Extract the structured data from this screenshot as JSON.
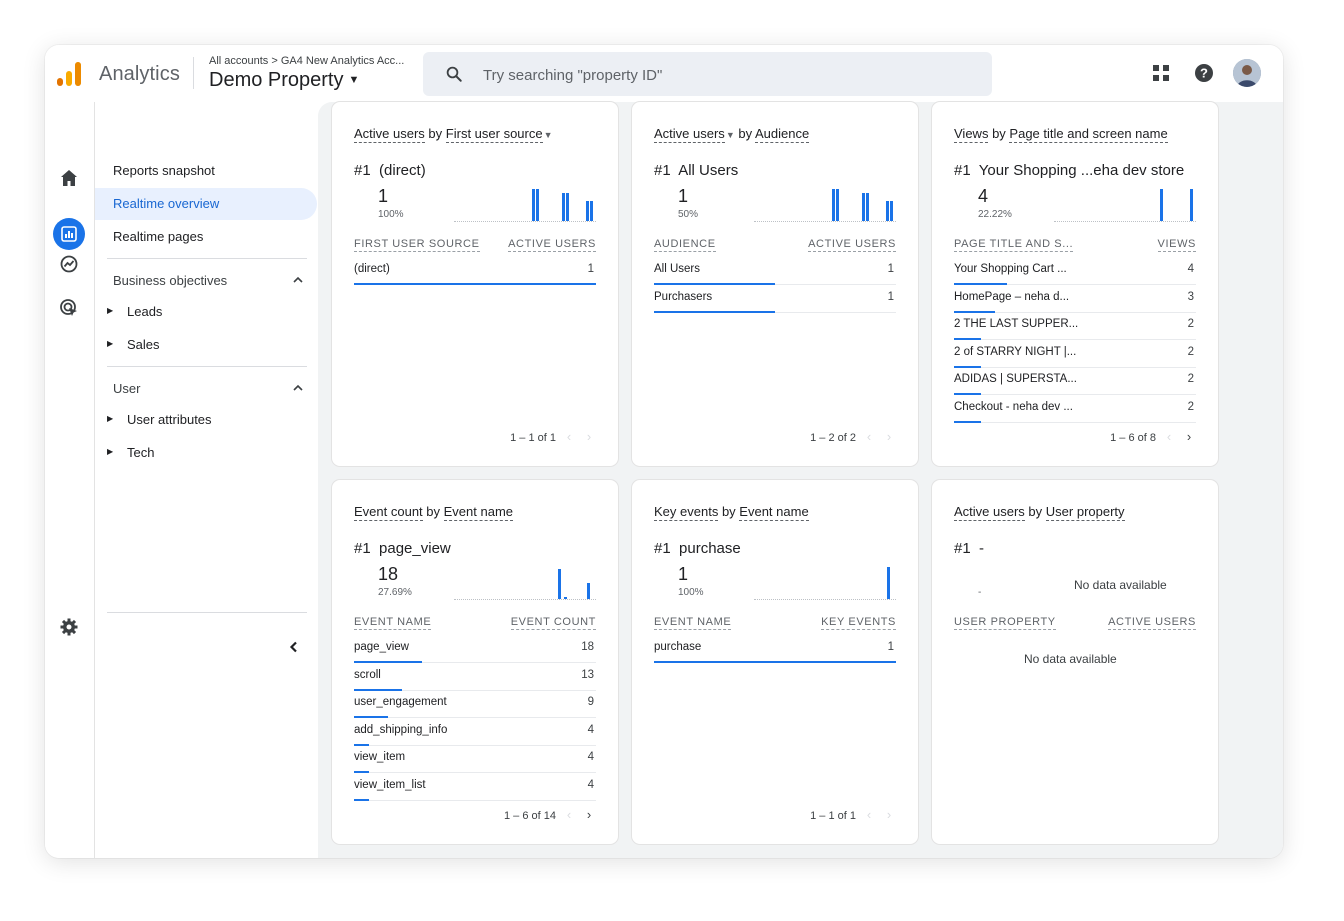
{
  "app": {
    "name": "Analytics",
    "breadcrumb": "All accounts > GA4 New Analytics Acc...",
    "property": "Demo Property"
  },
  "search": {
    "placeholder": "Try searching \"property ID\""
  },
  "header_icons": [
    "apps-grid-icon",
    "help-icon",
    "avatar"
  ],
  "rail_icons": [
    "home-icon",
    "reports-icon",
    "explore-icon",
    "advertising-icon",
    "settings-icon"
  ],
  "nav": {
    "items": [
      {
        "label": "Reports snapshot",
        "active": false
      },
      {
        "label": "Realtime overview",
        "active": true
      },
      {
        "label": "Realtime pages",
        "active": false
      }
    ],
    "sections": [
      {
        "title": "Business objectives",
        "children": [
          "Leads",
          "Sales"
        ]
      },
      {
        "title": "User",
        "children": [
          "User attributes",
          "Tech"
        ]
      }
    ]
  },
  "colors": {
    "accent": "#1a73e8",
    "active_bg": "#e8f0fe",
    "content_bg": "#f1f3f4"
  },
  "cards": [
    {
      "title_pre": "Active users",
      "title_mid": " by ",
      "title_post": "First user source",
      "dropdown_on": "post",
      "rank": "#1  (direct)",
      "value": "1",
      "pct": "100%",
      "spark": [
        20,
        20,
        28,
        28,
        32,
        32
      ],
      "col_left": "FIRST USER SOURCE",
      "col_right": "ACTIVE USERS",
      "rows": [
        {
          "k": "(direct)",
          "v": "1",
          "frac": 1.0
        }
      ],
      "pager": "1 – 1 of 1",
      "next_on": false
    },
    {
      "title_pre": "Active users",
      "title_mid": " by ",
      "title_post": "Audience",
      "dropdown_on": "pre",
      "rank": "#1  All Users",
      "value": "1",
      "pct": "50%",
      "spark": [
        20,
        20,
        28,
        28,
        32,
        32
      ],
      "col_left": "AUDIENCE",
      "col_right": "ACTIVE USERS",
      "rows": [
        {
          "k": "All Users",
          "v": "1",
          "frac": 0.5
        },
        {
          "k": "Purchasers",
          "v": "1",
          "frac": 0.5
        }
      ],
      "pager": "1 – 2 of 2",
      "next_on": false
    },
    {
      "title_pre": "Views",
      "title_mid": " by ",
      "title_post": "Page title and screen name",
      "dropdown_on": "none",
      "rank": "#1  Your Shopping ...eha dev store",
      "value": "4",
      "pct": "22.22%",
      "spark": [
        32,
        32
      ],
      "col_left": "PAGE TITLE AND S...",
      "col_right": "VIEWS",
      "rows": [
        {
          "k": "Your Shopping Cart ...",
          "v": "4",
          "frac": 0.22
        },
        {
          "k": "HomePage – neha d...",
          "v": "3",
          "frac": 0.17
        },
        {
          "k": "2 THE LAST SUPPER...",
          "v": "2",
          "frac": 0.11
        },
        {
          "k": "2 of STARRY NIGHT |...",
          "v": "2",
          "frac": 0.11
        },
        {
          "k": "ADIDAS | SUPERSTA...",
          "v": "2",
          "frac": 0.11
        },
        {
          "k": "Checkout - neha dev ...",
          "v": "2",
          "frac": 0.11
        }
      ],
      "pager": "1 – 6 of 8",
      "next_on": true
    },
    {
      "title_pre": "Event count",
      "title_mid": " by ",
      "title_post": "Event name",
      "dropdown_on": "none",
      "rank": "#1  page_view",
      "value": "18",
      "pct": "27.69%",
      "spark": [
        30,
        2,
        16
      ],
      "col_left": "EVENT NAME",
      "col_right": "EVENT COUNT",
      "rows": [
        {
          "k": "page_view",
          "v": "18",
          "frac": 0.28
        },
        {
          "k": "scroll",
          "v": "13",
          "frac": 0.2
        },
        {
          "k": "user_engagement",
          "v": "9",
          "frac": 0.14
        },
        {
          "k": "add_shipping_info",
          "v": "4",
          "frac": 0.06
        },
        {
          "k": "view_item",
          "v": "4",
          "frac": 0.06
        },
        {
          "k": "view_item_list",
          "v": "4",
          "frac": 0.06
        }
      ],
      "pager": "1 – 6 of 14",
      "next_on": true
    },
    {
      "title_pre": "Key events",
      "title_mid": " by ",
      "title_post": "Event name",
      "dropdown_on": "none",
      "rank": "#1  purchase",
      "value": "1",
      "pct": "100%",
      "spark": [
        32
      ],
      "col_left": "EVENT NAME",
      "col_right": "KEY EVENTS",
      "rows": [
        {
          "k": "purchase",
          "v": "1",
          "frac": 1.0
        }
      ],
      "pager": "1 – 1 of 1",
      "next_on": false
    },
    {
      "title_pre": "Active users",
      "title_mid": " by ",
      "title_post": "User property",
      "dropdown_on": "none",
      "rank": "#1  -",
      "value": "",
      "pct": "-",
      "spark": [],
      "col_left": "USER PROPERTY",
      "col_right": "ACTIVE USERS",
      "rows": [],
      "nodata_chart": "No data available",
      "nodata_table": "No data available",
      "pager": "",
      "next_on": false
    }
  ]
}
